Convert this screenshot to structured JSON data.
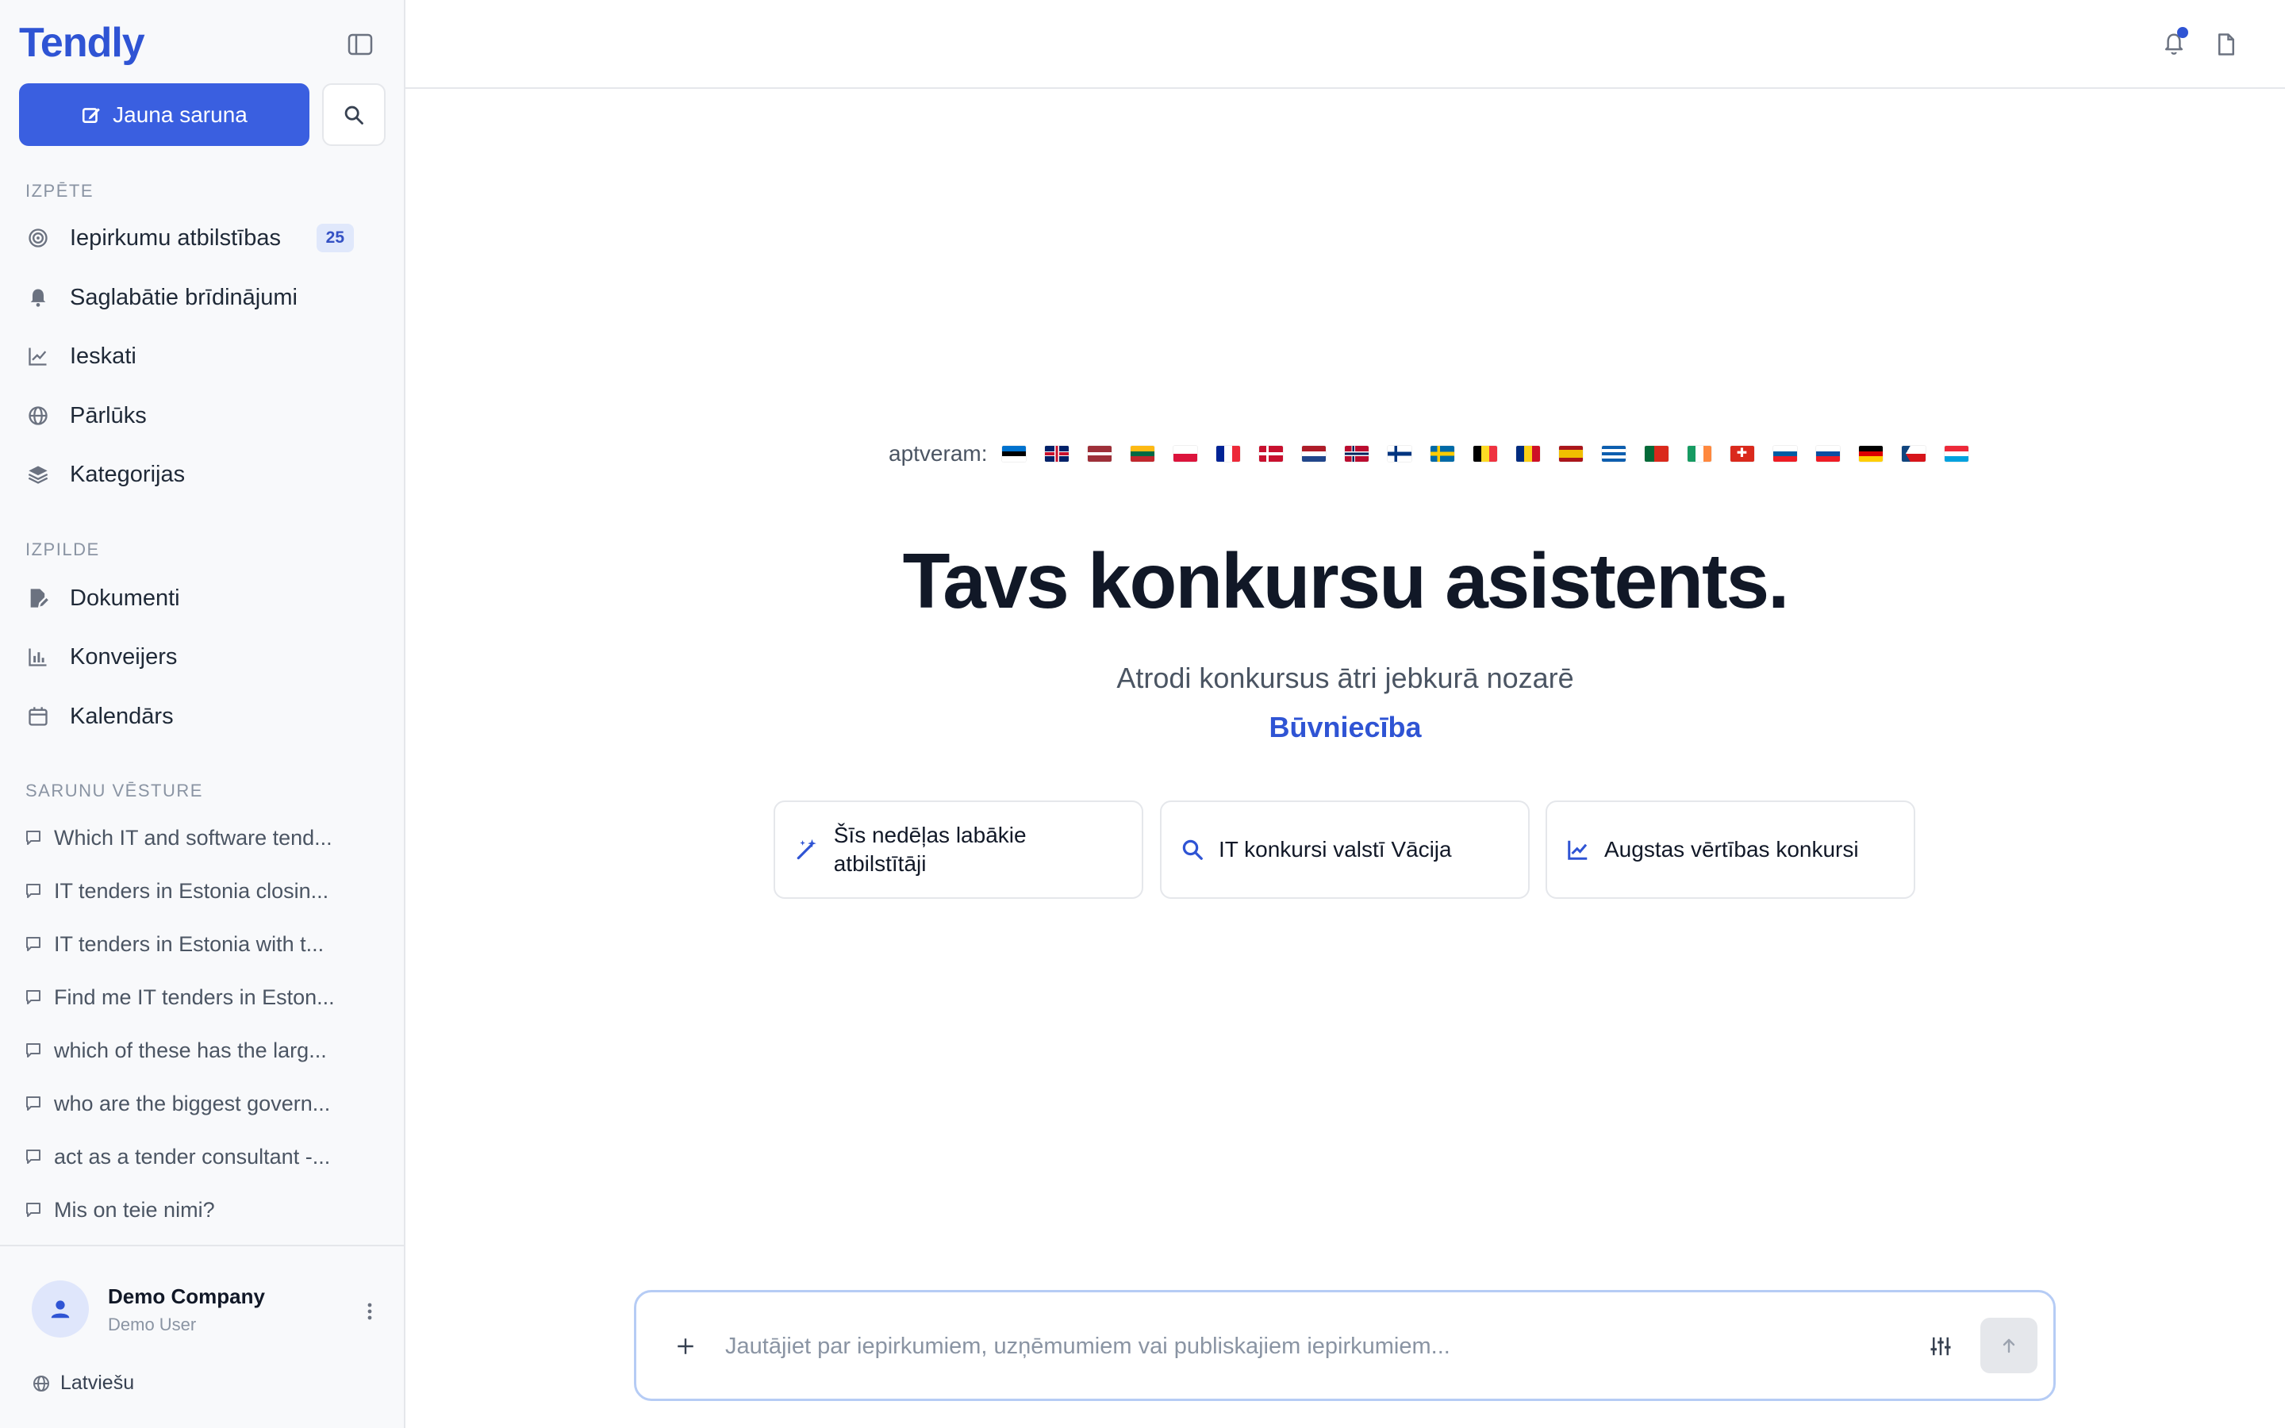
{
  "app": {
    "logo": "Tendly"
  },
  "sidebar": {
    "new_chat_label": "Jauna saruna",
    "sections": {
      "explore": "IZPĒTE",
      "execution": "IZPILDE",
      "history": "SARUNU VĒSTURE"
    },
    "explore_items": [
      {
        "label": "Iepirkumu atbilstības",
        "icon": "target-icon",
        "badge": "25"
      },
      {
        "label": "Saglabātie brīdinājumi",
        "icon": "bell-icon"
      },
      {
        "label": "Ieskati",
        "icon": "chart-line-icon"
      },
      {
        "label": "Pārlūks",
        "icon": "globe-icon"
      },
      {
        "label": "Kategorijas",
        "icon": "layers-icon"
      }
    ],
    "execution_items": [
      {
        "label": "Dokumenti",
        "icon": "file-edit-icon"
      },
      {
        "label": "Konveijers",
        "icon": "bar-chart-icon"
      },
      {
        "label": "Kalendārs",
        "icon": "calendar-icon"
      }
    ],
    "history_items": [
      "Which IT and software tend...",
      "IT tenders in Estonia closin...",
      "IT tenders in Estonia with t...",
      "Find me IT tenders in Eston...",
      "which of these has the larg...",
      "who are the biggest govern...",
      "act as a tender consultant -...",
      "Mis on teie nimi?"
    ],
    "user": {
      "name": "Demo Company",
      "role": "Demo User"
    },
    "language": "Latviešu"
  },
  "main": {
    "coverage_label": "aptveram:",
    "coverage_flags": [
      "EE",
      "GB",
      "LV",
      "LT",
      "PL",
      "FR",
      "DK",
      "NL",
      "NO",
      "FI",
      "SE",
      "BE",
      "RO",
      "ES",
      "GR",
      "PT",
      "IE",
      "CH",
      "SI",
      "SK",
      "DE",
      "CZ",
      "LU"
    ],
    "title": "Tavs konkursu asistents.",
    "subtitle": "Atrodi konkursus ātri jebkurā nozarē",
    "accent": "Būvniecība",
    "suggestions": [
      {
        "label": "Šīs nedēļas labākie atbilstītāji",
        "icon": "magic-wand-icon"
      },
      {
        "label": "IT konkursi valstī Vācija",
        "icon": "search-icon"
      },
      {
        "label": "Augstas vērtības konkursi",
        "icon": "trend-icon"
      }
    ],
    "composer": {
      "placeholder": "Jautājiet par iepirkumiem, uzņēmumiem vai publiskajiem iepirkumiem..."
    }
  },
  "colors": {
    "brand": "#2f54d4",
    "primary_button": "#3a5fe0",
    "sidebar_bg": "#f8f9fb",
    "composer_border": "#b6ccf5"
  }
}
